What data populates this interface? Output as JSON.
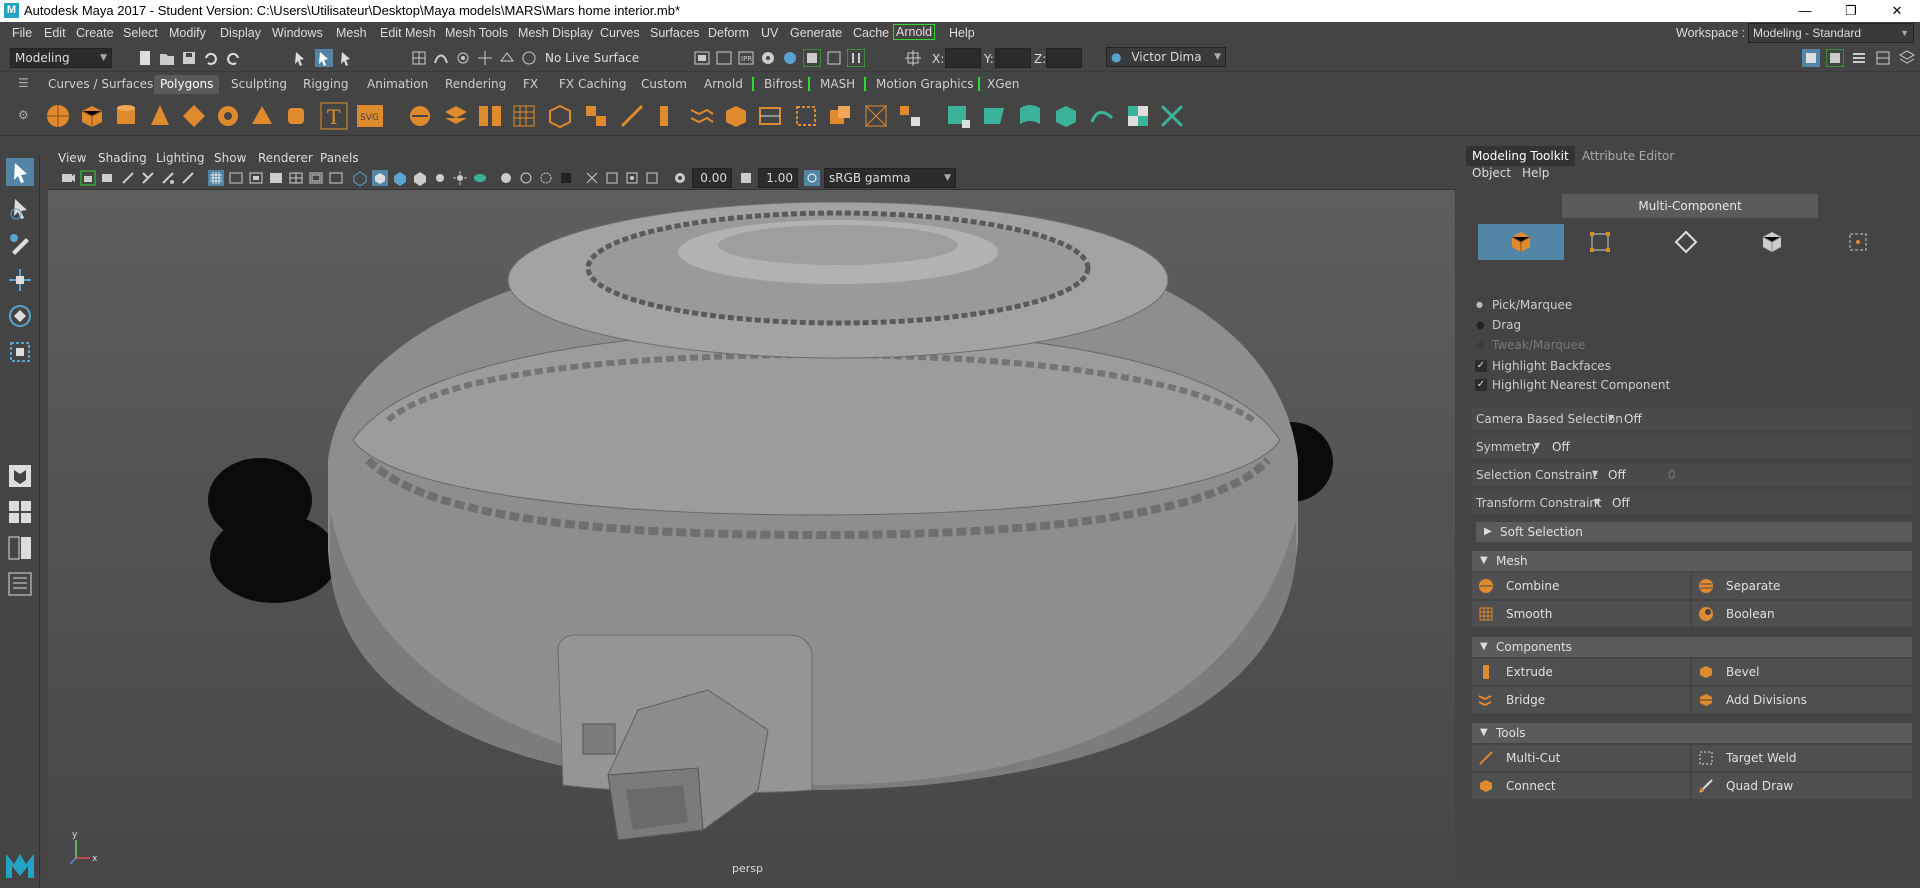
{
  "titlebar": {
    "logo": "M",
    "title": "Autodesk Maya 2017 - Student Version: C:\\Users\\Utilisateur\\Desktop\\Maya models\\MARS\\Mars home interior.mb*",
    "minimize": "—",
    "restore": "❐",
    "close": "✕"
  },
  "menubar": {
    "items": [
      "File",
      "Edit",
      "Create",
      "Select",
      "Modify",
      "Display",
      "Windows",
      "Mesh",
      "Edit Mesh",
      "Mesh Tools",
      "Mesh Display",
      "Curves",
      "Surfaces",
      "Deform",
      "UV",
      "Generate",
      "Cache",
      "Arnold",
      "Help"
    ],
    "workspace_label": "Workspace :",
    "workspace_value": "Modeling - Standard"
  },
  "statusline": {
    "mode": "Modeling",
    "live_surface": "No Live Surface",
    "x_label": "X:",
    "y_label": "Y:",
    "z_label": "Z:",
    "user": "Victor Dima"
  },
  "shelf_tabs": [
    "Curves / Surfaces",
    "Polygons",
    "Sculpting",
    "Rigging",
    "Animation",
    "Rendering",
    "FX",
    "FX Caching",
    "Custom",
    "Arnold",
    "Bifrost",
    "MASH",
    "Motion Graphics",
    "XGen"
  ],
  "shelf_active": "Polygons",
  "viewport": {
    "menus": [
      "View",
      "Shading",
      "Lighting",
      "Show",
      "Renderer",
      "Panels"
    ],
    "exposure": "0.00",
    "gamma": "1.00",
    "colorspace": "sRGB gamma",
    "camera_label": "persp",
    "axis_x": "x",
    "axis_y": "y"
  },
  "toolkit": {
    "tabs": [
      "Modeling Toolkit",
      "Attribute Editor"
    ],
    "menu": [
      "Object",
      "Help"
    ],
    "mode_title": "Multi-Component",
    "selection_options": {
      "pick": "Pick/Marquee",
      "drag": "Drag",
      "tweak": "Tweak/Marquee",
      "highlight_backfaces": "Highlight Backfaces",
      "highlight_nearest": "Highlight Nearest Component"
    },
    "camera_based_selection": {
      "label": "Camera Based Selection",
      "value": "Off"
    },
    "symmetry": {
      "label": "Symmetry",
      "value": "Off"
    },
    "selection_constraint": {
      "label": "Selection Constraint",
      "value": "Off",
      "extra": "0"
    },
    "transform_constraint": {
      "label": "Transform Constraint",
      "value": "Off"
    },
    "soft_selection": "Soft Selection",
    "mesh_section": "Mesh",
    "components_section": "Components",
    "tools_section": "Tools",
    "buttons": {
      "combine": "Combine",
      "separate": "Separate",
      "smooth": "Smooth",
      "boolean": "Boolean",
      "extrude": "Extrude",
      "bevel": "Bevel",
      "bridge": "Bridge",
      "add_divisions": "Add Divisions",
      "multi_cut": "Multi-Cut",
      "target_weld": "Target Weld",
      "connect": "Connect",
      "quad_draw": "Quad Draw"
    }
  },
  "colors": {
    "accent_orange": "#e08a2e",
    "selected_blue": "#5285a6",
    "green_bracket": "#2fd62f"
  }
}
